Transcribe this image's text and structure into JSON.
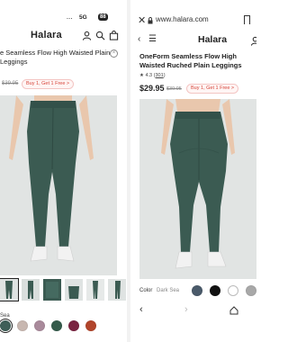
{
  "left": {
    "status": {
      "dots": "...",
      "network": "5G",
      "battery": "88"
    },
    "header": {
      "logo": "Halara"
    },
    "product": {
      "title": "e Seamless Flow High Waisted Plain Leggings",
      "old_price": "$39.95",
      "promo": "Buy 1, Get 1 Free >"
    },
    "swatches": {
      "label": "Sea",
      "colors": [
        "#3f5f58",
        "#c8b7b0",
        "#a98a9b",
        "#355b4b",
        "#7a2340",
        "#b1442b"
      ]
    }
  },
  "right": {
    "browser": {
      "url": "www.halara.com"
    },
    "header": {
      "logo": "Halara"
    },
    "product": {
      "title": "OneForm Seamless Flow High Waisted Ruched Plain Leggings",
      "rating": "4.3",
      "review_count": "301",
      "price": "$29.95",
      "old_price": "$39.95",
      "promo": "Buy 1, Get 1 Free >"
    },
    "swatches": {
      "label": "Color",
      "value": "Dark Sea",
      "colors": [
        "#4a5a6a",
        "#111111",
        "#ffffff",
        "#a8a8a8"
      ]
    }
  },
  "theme": {
    "legging_color": "#3b5b52",
    "promo_text": "#d6453a",
    "promo_bg": "#fff5f4"
  }
}
